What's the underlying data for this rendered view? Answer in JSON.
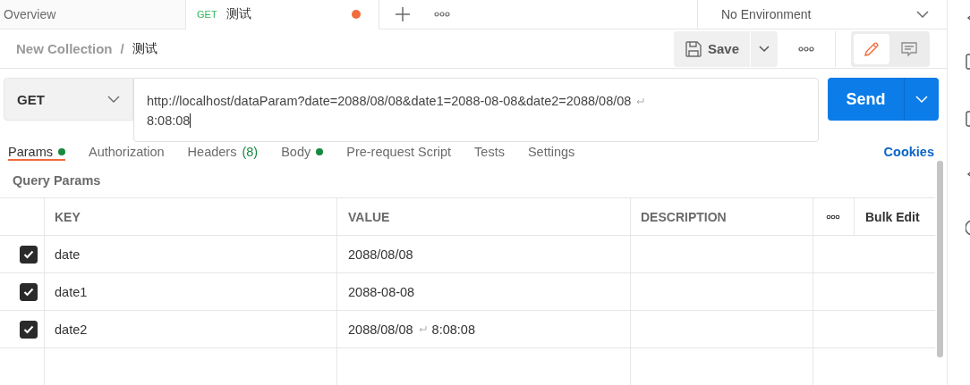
{
  "tabs": [
    {
      "label": "Overview",
      "selected": false,
      "unsaved": false
    },
    {
      "label": "测试",
      "method": "GET",
      "selected": true,
      "unsaved": true
    }
  ],
  "environment": {
    "label": "No Environment"
  },
  "breadcrumb": {
    "collection": "New Collection",
    "separator": "/",
    "request": "测试"
  },
  "toolbar": {
    "save_label": "Save",
    "modes": [
      {
        "kind": "edit",
        "selected": true
      },
      {
        "kind": "comment",
        "selected": false
      }
    ]
  },
  "request": {
    "method": "GET",
    "url_lines": [
      "http://localhost/dataParam?date=2088/08/08&date1=2088-08-08&date2=2088/08/08",
      "8:08:08"
    ],
    "send_label": "Send"
  },
  "request_tabs": [
    {
      "label": "Params",
      "dot": true,
      "selected": true
    },
    {
      "label": "Authorization",
      "dot": false,
      "selected": false
    },
    {
      "label": "Headers",
      "count": "(8)",
      "dot": false,
      "selected": false
    },
    {
      "label": "Body",
      "dot": true,
      "selected": false
    },
    {
      "label": "Pre-request Script",
      "dot": false,
      "selected": false
    },
    {
      "label": "Tests",
      "dot": false,
      "selected": false
    },
    {
      "label": "Settings",
      "dot": false,
      "selected": false
    }
  ],
  "cookies_link": "Cookies",
  "section_title": "Query Params",
  "table": {
    "columns": [
      "KEY",
      "VALUE",
      "DESCRIPTION"
    ],
    "bulk_edit": "Bulk Edit",
    "rows": [
      {
        "checked": true,
        "key": "date",
        "value_lines": [
          "2088/08/08"
        ]
      },
      {
        "checked": true,
        "key": "date1",
        "value_lines": [
          "2088-08-08"
        ]
      },
      {
        "checked": true,
        "key": "date2",
        "value_lines": [
          "2088/08/08",
          "8:08:08"
        ]
      }
    ]
  }
}
